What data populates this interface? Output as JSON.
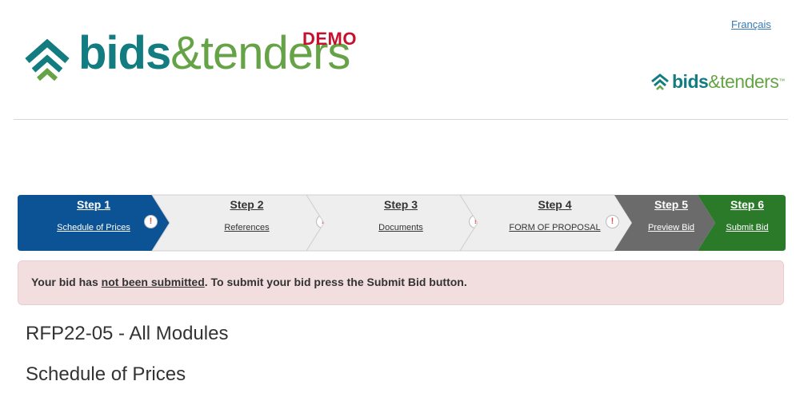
{
  "header": {
    "language_link": "Français",
    "logo": {
      "bids": "bids",
      "amp": "&",
      "tenders": "tenders",
      "demo": "DEMO"
    },
    "small_logo": {
      "bids": "bids",
      "amp": "&",
      "tenders": "tenders",
      "tm": "™"
    }
  },
  "steps": [
    {
      "title": "Step 1",
      "label": "Schedule of Prices",
      "state": "active",
      "warning": "!"
    },
    {
      "title": "Step 2",
      "label": "References",
      "state": "incomplete",
      "warning": "!"
    },
    {
      "title": "Step 3",
      "label": "Documents",
      "state": "incomplete",
      "warning": "!"
    },
    {
      "title": "Step 4",
      "label": "FORM OF PROPOSAL",
      "state": "incomplete",
      "warning": "!"
    },
    {
      "title": "Step 5",
      "label": "Preview Bid",
      "state": "preview"
    },
    {
      "title": "Step 6",
      "label": "Submit Bid",
      "state": "submit"
    }
  ],
  "colors": {
    "active": "#0b5394",
    "incomplete": "#eeeeee",
    "preview": "#6b6b6b",
    "submit": "#2a7a2a",
    "alert_bg": "#f2dede",
    "brand_teal": "#127c80",
    "brand_green": "#66a346",
    "demo_red": "#c8102e"
  },
  "alert": {
    "prefix": "Your bid has ",
    "emphasis": "not been submitted",
    "suffix": ". To submit your bid press the Submit Bid button."
  },
  "main": {
    "rfp_title": "RFP22-05 - All Modules",
    "section_title": "Schedule of Prices"
  }
}
